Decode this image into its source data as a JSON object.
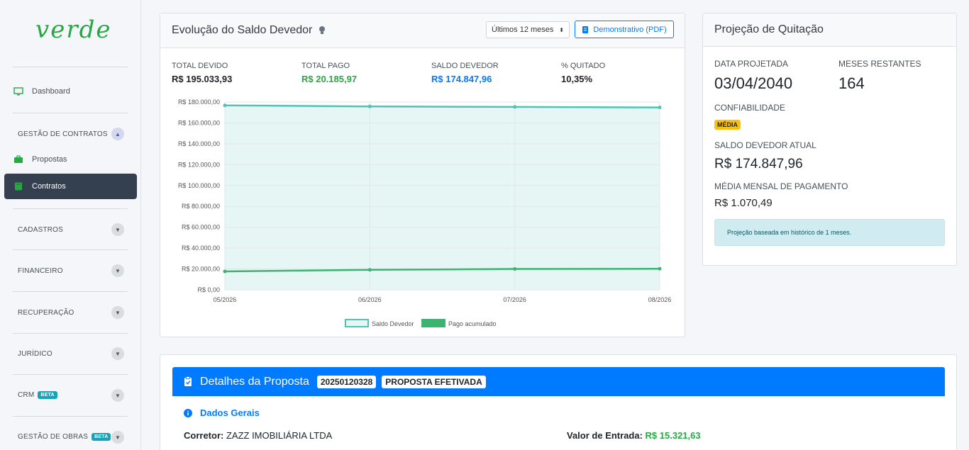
{
  "brand": {
    "logo_text": "verde"
  },
  "sidebar": {
    "dashboard": "Dashboard",
    "gestao_contratos": "GESTÃO DE CONTRATOS",
    "propostas": "Propostas",
    "contratos": "Contratos",
    "cadastros": "CADASTROS",
    "financeiro": "FINANCEIRO",
    "recuperacao": "RECUPERAÇÃO",
    "juridico": "JURÍDICO",
    "crm": "CRM",
    "gestao_obras": "GESTÃO DE OBRAS",
    "beta": "BETA"
  },
  "evolution": {
    "title": "Evolução do Saldo Devedor",
    "period_select": "Últimos 12 meses",
    "pdf_button": "Demonstrativo (PDF)",
    "stats": {
      "total_devido_label": "TOTAL DEVIDO",
      "total_devido": "R$ 195.033,93",
      "total_pago_label": "TOTAL PAGO",
      "total_pago": "R$ 20.185,97",
      "saldo_devedor_label": "SALDO DEVEDOR",
      "saldo_devedor": "R$ 174.847,96",
      "quitado_label": "% QUITADO",
      "quitado": "10,35%"
    }
  },
  "chart_data": {
    "type": "area",
    "categories": [
      "05/2026",
      "06/2026",
      "07/2026",
      "08/2026"
    ],
    "y_ticks": [
      "R$ 0,00",
      "R$ 20.000,00",
      "R$ 40.000,00",
      "R$ 60.000,00",
      "R$ 80.000,00",
      "R$ 100.000,00",
      "R$ 120.000,00",
      "R$ 140.000,00",
      "R$ 160.000,00",
      "R$ 180.000,00"
    ],
    "ylim": [
      0,
      180000
    ],
    "series": [
      {
        "name": "Saldo Devedor",
        "values": [
          176800,
          175800,
          175300,
          174848
        ],
        "color": "#4fc3b4",
        "fill": "#e6f6f4"
      },
      {
        "name": "Pago acumulado",
        "values": [
          17700,
          19200,
          20000,
          20186
        ],
        "color": "#3cb371"
      }
    ],
    "legend_position": "bottom",
    "grid": true
  },
  "projection": {
    "title": "Projeção de Quitação",
    "data_projetada_label": "DATA PROJETADA",
    "data_projetada": "03/04/2040",
    "meses_restantes_label": "MESES RESTANTES",
    "meses_restantes": "164",
    "confiabilidade_label": "CONFIABILIDADE",
    "confiabilidade": "MÉDIA",
    "saldo_label": "SALDO DEVEDOR ATUAL",
    "saldo": "R$ 174.847,96",
    "media_label": "MÉDIA MENSAL DE PAGAMENTO",
    "media": "R$ 1.070,49",
    "note": "Projeção baseada em histórico de 1 meses."
  },
  "details": {
    "title": "Detalhes da Proposta",
    "code": "20250120328",
    "status": "PROPOSTA EFETIVADA",
    "section": "Dados Gerais",
    "corretor_label": "Corretor:",
    "corretor": "ZAZZ IMOBILIÁRIA LTDA",
    "entrada_label": "Valor de Entrada:",
    "entrada": "R$ 15.321,63"
  }
}
